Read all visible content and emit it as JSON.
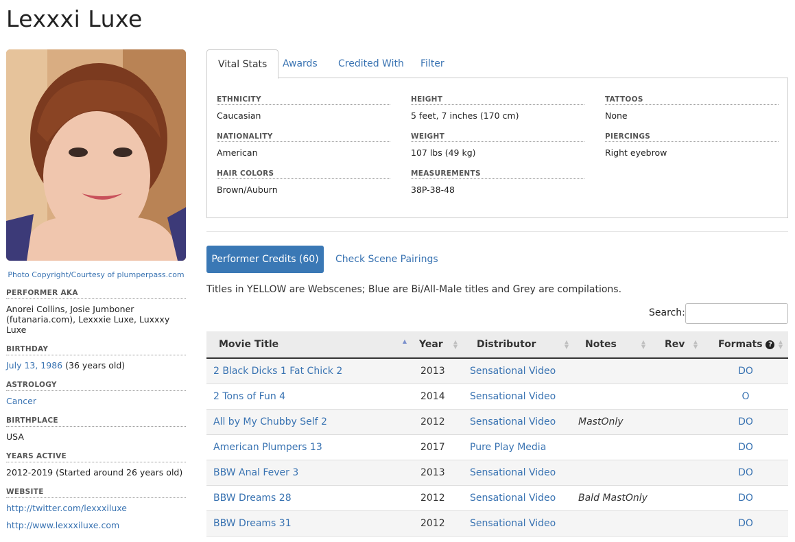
{
  "performer_name": "Lexxxi Luxe",
  "photo_caption": "Photo Copyright/Courtesy of plumperpass.com",
  "bio": {
    "aka_label": "PERFORMER AKA",
    "aka_value": "Anorei Collins, Josie Jumboner (futanaria.com), Lexxxie Luxe, Luxxxy Luxe",
    "birthday_label": "BIRTHDAY",
    "birthday_date": "July 13, 1986",
    "birthday_age": "(36 years old)",
    "astrology_label": "ASTROLOGY",
    "astrology_value": "Cancer",
    "birthplace_label": "BIRTHPLACE",
    "birthplace_value": "USA",
    "years_active_label": "YEARS ACTIVE",
    "years_active_value": "2012-2019 (Started around 26 years old)",
    "website_label": "WEBSITE",
    "website_1": "http://twitter.com/lexxxiluxe",
    "website_2": "http://www.lexxxiluxe.com"
  },
  "tabs": [
    "Vital Stats",
    "Awards",
    "Credited With",
    "Filter"
  ],
  "vitals": {
    "ethnicity_label": "ETHNICITY",
    "ethnicity": "Caucasian",
    "nationality_label": "NATIONALITY",
    "nationality": "American",
    "hair_label": "HAIR COLORS",
    "hair": "Brown/Auburn",
    "height_label": "HEIGHT",
    "height": "5 feet, 7 inches (170 cm)",
    "weight_label": "WEIGHT",
    "weight": "107 lbs (49 kg)",
    "measurements_label": "MEASUREMENTS",
    "measurements": "38P-38-48",
    "tattoos_label": "TATTOOS",
    "tattoos": "None",
    "piercings_label": "PIERCINGS",
    "piercings": "Right eyebrow"
  },
  "credits_button": "Performer Credits (60)",
  "pairings_link": "Check Scene Pairings",
  "legend_note": "Titles in YELLOW are Webscenes; Blue are Bi/All-Male titles and Grey are compilations.",
  "search_label": "Search:",
  "search_value": "",
  "table": {
    "headers": [
      "Movie Title",
      "Year",
      "Distributor",
      "Notes",
      "Rev",
      "Formats"
    ],
    "rows": [
      {
        "title": "2 Black Dicks 1 Fat Chick 2",
        "year": "2013",
        "distributor": "Sensational Video",
        "notes": "",
        "rev": "",
        "formats": "DO"
      },
      {
        "title": "2 Tons of Fun 4",
        "year": "2014",
        "distributor": "Sensational Video",
        "notes": "",
        "rev": "",
        "formats": "O"
      },
      {
        "title": "All by My Chubby Self 2",
        "year": "2012",
        "distributor": "Sensational Video",
        "notes": "MastOnly",
        "rev": "",
        "formats": "DO"
      },
      {
        "title": "American Plumpers 13",
        "year": "2017",
        "distributor": "Pure Play Media",
        "notes": "",
        "rev": "",
        "formats": "DO"
      },
      {
        "title": "BBW Anal Fever 3",
        "year": "2013",
        "distributor": "Sensational Video",
        "notes": "",
        "rev": "",
        "formats": "DO"
      },
      {
        "title": "BBW Dreams 28",
        "year": "2012",
        "distributor": "Sensational Video",
        "notes": "Bald MastOnly",
        "rev": "",
        "formats": "DO"
      },
      {
        "title": "BBW Dreams 31",
        "year": "2012",
        "distributor": "Sensational Video",
        "notes": "",
        "rev": "",
        "formats": "DO"
      }
    ]
  },
  "colors": {
    "link": "#3973b2",
    "button": "#3a78b5"
  },
  "icons": {
    "help": "question-circle-icon",
    "sort": "sort-arrows-icon"
  }
}
